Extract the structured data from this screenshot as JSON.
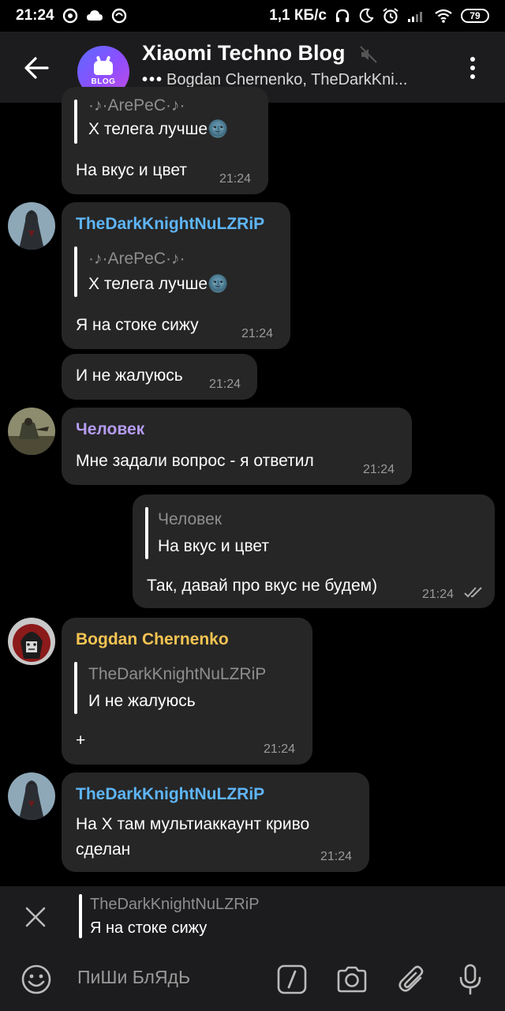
{
  "status_bar": {
    "time": "21:24",
    "network_speed": "1,1 КБ/с",
    "battery": "79"
  },
  "header": {
    "title": "Xiaomi Techno Blog",
    "avatar_label": "BLOG",
    "typing_indicator": "•••",
    "subtitle": "Bogdan Chernenko, TheDarkKni..."
  },
  "messages": [
    {
      "reply_to_name": "·♪·ArePeC·♪·",
      "reply_to_text": "Х телега лучше🌚",
      "text": "На вкус и цвет",
      "time": "21:24"
    },
    {
      "sender": "TheDarkKnightNuLZRiP",
      "sender_color": "#5eb5f7",
      "reply_to_name": "·♪·ArePeC·♪·",
      "reply_to_text": "Х телега лучше🌚",
      "text": "Я на стоке сижу",
      "time": "21:24"
    },
    {
      "text": "И не жалуюсь",
      "time": "21:24"
    },
    {
      "sender": "Человек",
      "sender_color": "#b59cf0",
      "text": "Мне задали вопрос - я ответил",
      "time": "21:24"
    },
    {
      "outgoing": true,
      "reply_to_name": "Человек",
      "reply_to_text": "На вкус и цвет",
      "text": "Так, давай про вкус не будем)",
      "time": "21:24",
      "read": true
    },
    {
      "sender": "Bogdan Chernenko",
      "sender_color": "#f5c452",
      "reply_to_name": "TheDarkKnightNuLZRiP",
      "reply_to_text": "И не жалуюсь",
      "text": "+",
      "time": "21:24"
    },
    {
      "sender": "TheDarkKnightNuLZRiP",
      "sender_color": "#5eb5f7",
      "text_line1": "На Х там мультиаккаунт криво",
      "text_line2": "сделан",
      "time": "21:24"
    }
  ],
  "reply_panel": {
    "name": "TheDarkKnightNuLZRiP",
    "text": "Я на стоке сижу"
  },
  "input": {
    "placeholder": "ПиШи БлЯдЬ"
  },
  "icons": {
    "back": "arrow-left-icon",
    "mute": "muted-speaker-icon",
    "more": "more-vertical-icon",
    "close": "close-icon",
    "emoji": "emoji-icon",
    "commands": "slash-command-icon",
    "camera": "camera-icon",
    "attach": "paperclip-icon",
    "mic": "microphone-icon"
  }
}
